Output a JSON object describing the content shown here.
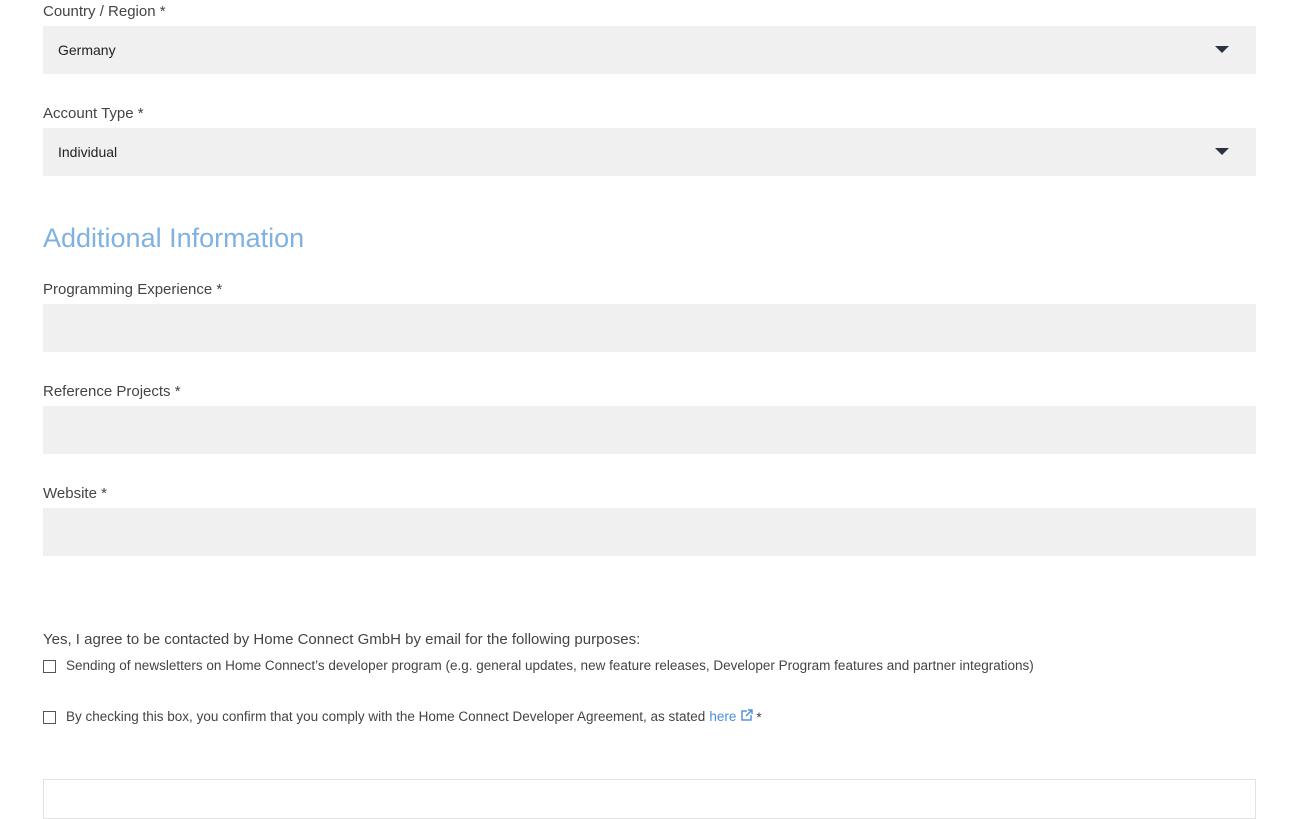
{
  "country": {
    "label": "Country / Region *",
    "value": "Germany",
    "icon": "chevron-down-icon"
  },
  "account_type": {
    "label": "Account Type *",
    "value": "Individual",
    "icon": "chevron-down-icon"
  },
  "additional": {
    "title": "Additional Information",
    "programming_experience": {
      "label": "Programming Experience *",
      "value": ""
    },
    "reference_projects": {
      "label": "Reference Projects *",
      "value": ""
    },
    "website": {
      "label": "Website *",
      "value": ""
    }
  },
  "consent": {
    "intro": "Yes, I agree to be contacted by Home Connect GmbH by email for the following purposes:",
    "newsletter": {
      "text": "Sending of newsletters on Home Connect’s developer program (e.g. general updates, new feature releases, Developer Program features and partner integrations)",
      "checked": false
    },
    "agreement": {
      "text": "By checking this box, you confirm that you comply with the Home Connect Developer Agreement, as stated",
      "link_text": "here",
      "link_icon": "external-link-icon",
      "required_marker": "*",
      "checked": false
    }
  },
  "colors": {
    "field_bg": "#f0f0f0",
    "section_title": "#7fb2df",
    "link": "#4a90d9",
    "caret": "#2b3340"
  }
}
